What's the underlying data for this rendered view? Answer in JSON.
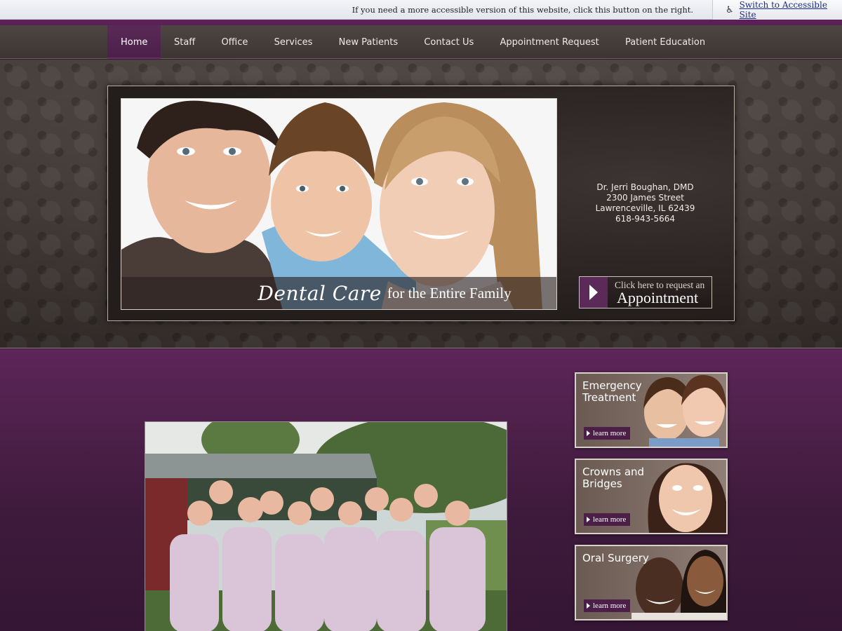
{
  "accessibility": {
    "notice": "If you need a more accessible version of this website, click this button on the right.",
    "icon": "wheelchair-icon",
    "link_label": "Switch to Accessible Site"
  },
  "nav": {
    "items": [
      {
        "label": "Home",
        "active": true
      },
      {
        "label": "Staff",
        "active": false
      },
      {
        "label": "Office",
        "active": false
      },
      {
        "label": "Services",
        "active": false
      },
      {
        "label": "New Patients",
        "active": false
      },
      {
        "label": "Contact Us",
        "active": false
      },
      {
        "label": "Appointment Request",
        "active": false
      },
      {
        "label": "Patient Education",
        "active": false
      }
    ]
  },
  "hero": {
    "caption_script": "Dental Care",
    "caption_rest": "for the Entire Family",
    "contact": {
      "name": "Dr. Jerri Boughan, DMD",
      "street": "2300 James Street",
      "city": "Lawrenceville, IL 62439",
      "phone": "618-943-5664"
    },
    "appointment": {
      "small": "Click here to request an",
      "big": "Appointment"
    }
  },
  "promos": [
    {
      "title": "Emergency Treatment",
      "button": "learn more"
    },
    {
      "title": "Crowns and Bridges",
      "button": "learn more"
    },
    {
      "title": "Oral Surgery",
      "button": "learn more"
    }
  ],
  "colors": {
    "brand_purple": "#5b2157",
    "nav_bg": "#453d3a",
    "accent_link": "#1a2b8c"
  }
}
